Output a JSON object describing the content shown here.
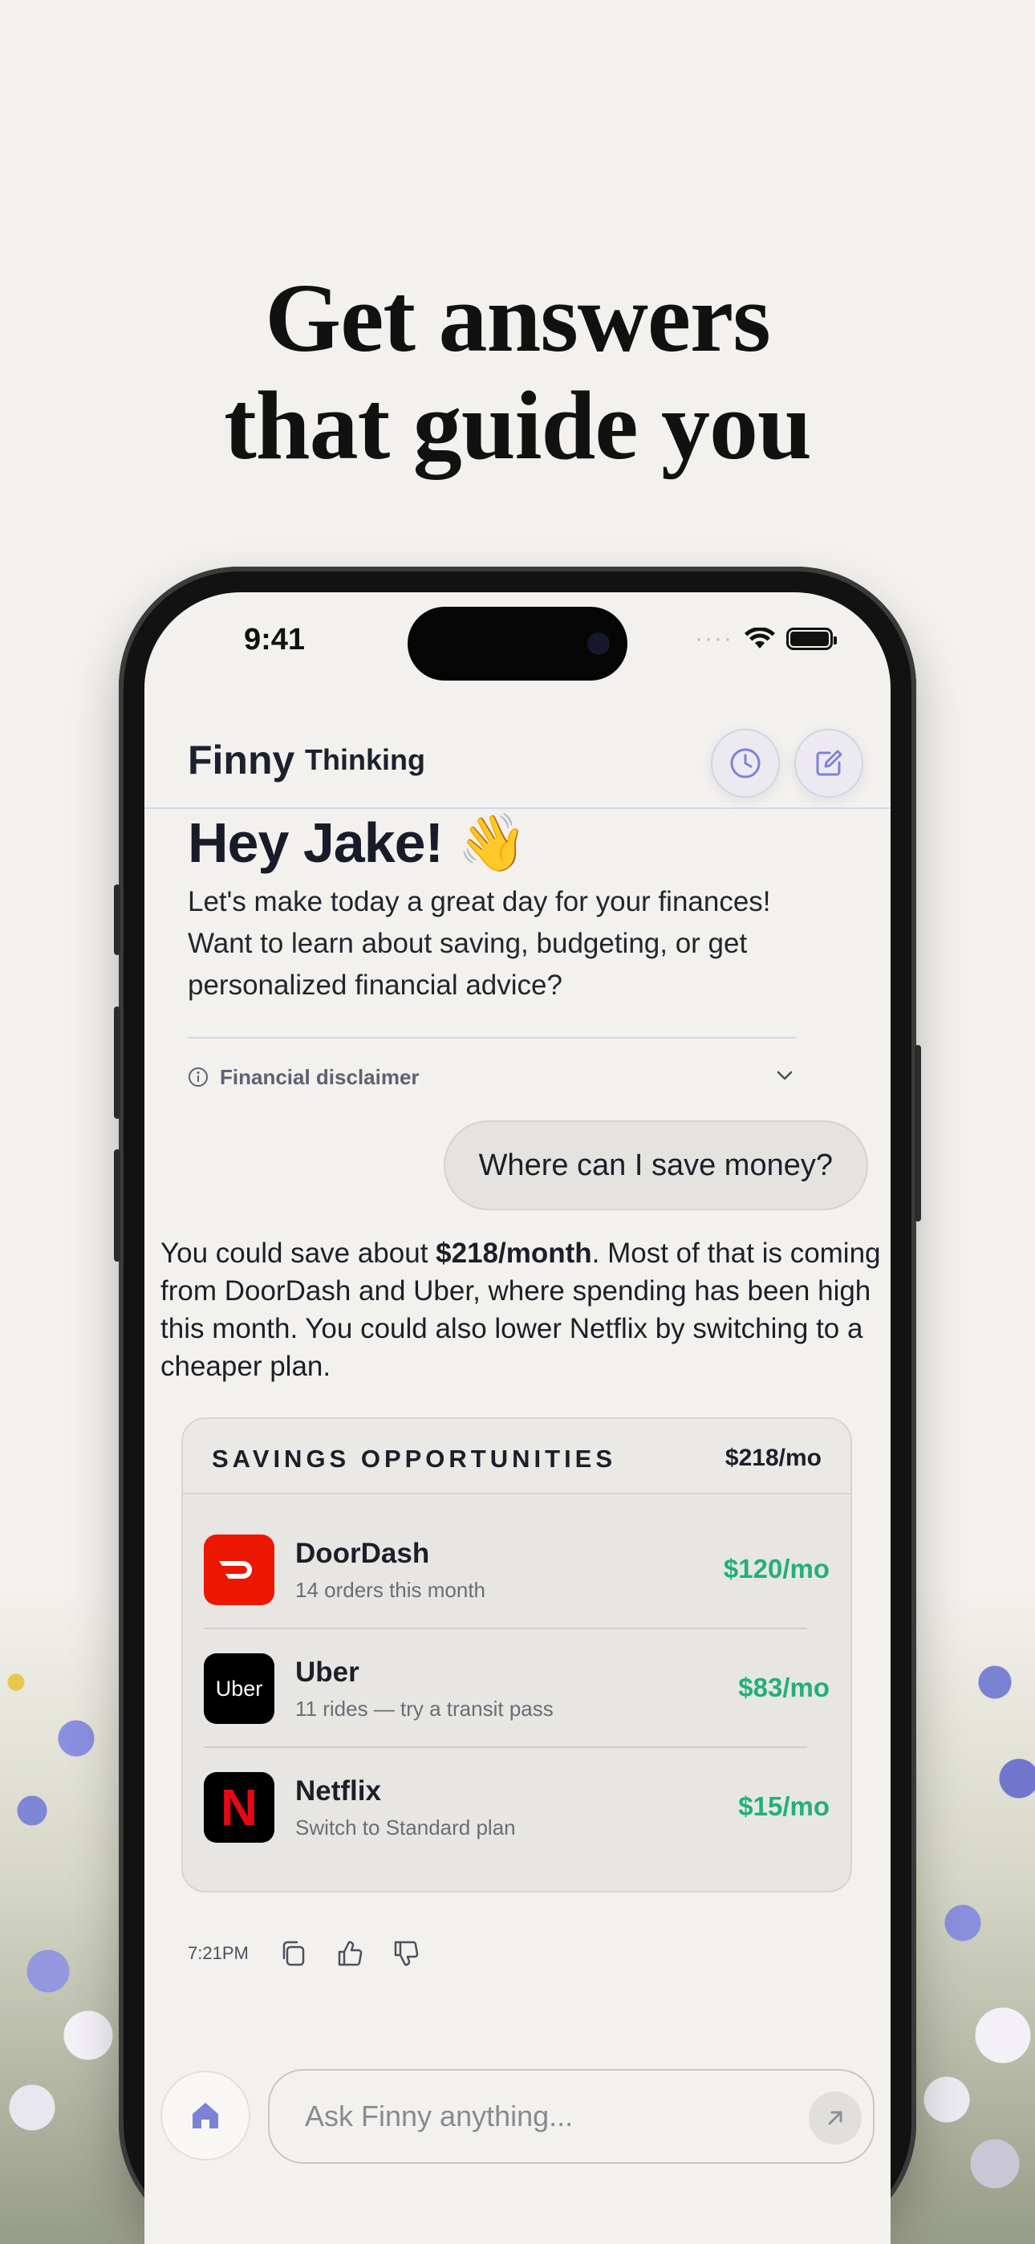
{
  "headline": {
    "line1": "Get answers",
    "line2": "that guide you"
  },
  "status_bar": {
    "time": "9:41",
    "signal_icon": "signal-icon",
    "wifi_icon": "wifi-icon",
    "battery_icon": "battery-icon"
  },
  "header": {
    "title": "Finny",
    "subtitle": "Thinking",
    "history_icon": "clock-icon",
    "new_chat_icon": "compose-icon"
  },
  "greeting": {
    "text": "Hey Jake! 👋"
  },
  "intro": "Let's make today a great day for your finances! Want to learn about saving, budgeting, or get personalized financial advice?",
  "disclaimer": {
    "label": "Financial disclaimer",
    "icon": "info-icon",
    "toggle_icon": "chevron-down-icon"
  },
  "user_message": "Where can I save money?",
  "answer": {
    "before": "You could save about ",
    "bold": "$218/month",
    "after": ". Most of that is coming from DoorDash and Uber, where spending has been high this month. You could also lower Netflix by switching to a cheaper plan."
  },
  "savings_card": {
    "title": "SAVINGS OPPORTUNITIES",
    "total": "$218/mo",
    "items": [
      {
        "name": "DoorDash",
        "note": "14 orders this month",
        "amount": "$120/mo",
        "logo": "doordash-logo",
        "logo_color": "#eb1700"
      },
      {
        "name": "Uber",
        "note": "11 rides — try a transit pass",
        "amount": "$83/mo",
        "logo": "uber-logo",
        "logo_text": "Uber",
        "logo_color": "#000000"
      },
      {
        "name": "Netflix",
        "note": "Switch to Standard plan",
        "amount": "$15/mo",
        "logo": "netflix-logo",
        "logo_text": "N",
        "logo_color": "#000000"
      }
    ]
  },
  "message_meta": {
    "time": "7:21PM",
    "copy_icon": "copy-icon",
    "like_icon": "thumbs-up-icon",
    "dislike_icon": "thumbs-down-icon"
  },
  "composer": {
    "placeholder": "Ask Finny anything...",
    "home_icon": "home-icon",
    "send_icon": "send-arrow-icon"
  },
  "colors": {
    "accent": "#7b83d6",
    "positive": "#22b07a",
    "background": "#f3f1ed"
  }
}
